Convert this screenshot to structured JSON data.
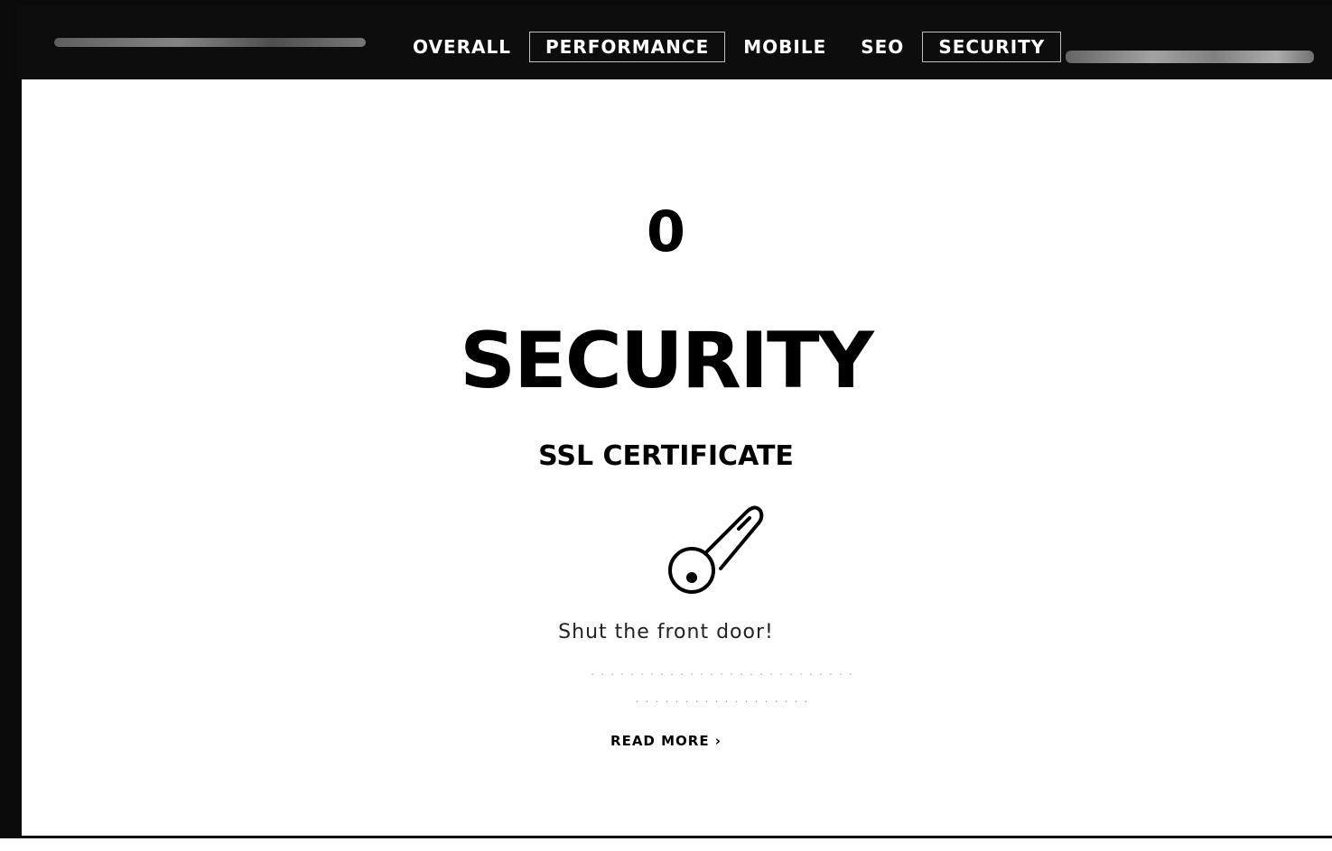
{
  "nav": {
    "tabs": [
      {
        "label": "OVERALL"
      },
      {
        "label": "PERFORMANCE"
      },
      {
        "label": "MOBILE"
      },
      {
        "label": "SEO"
      },
      {
        "label": "SECURITY"
      }
    ]
  },
  "main": {
    "score": "0",
    "title": "SECURITY",
    "subtitle": "SSL CERTIFICATE",
    "icon": "key-icon",
    "tagline": "Shut the front door!",
    "read_more": "READ MORE ›"
  },
  "colors": {
    "nav_bg": "#0d0d0d",
    "page_bg": "#ffffff",
    "text": "#000000"
  }
}
